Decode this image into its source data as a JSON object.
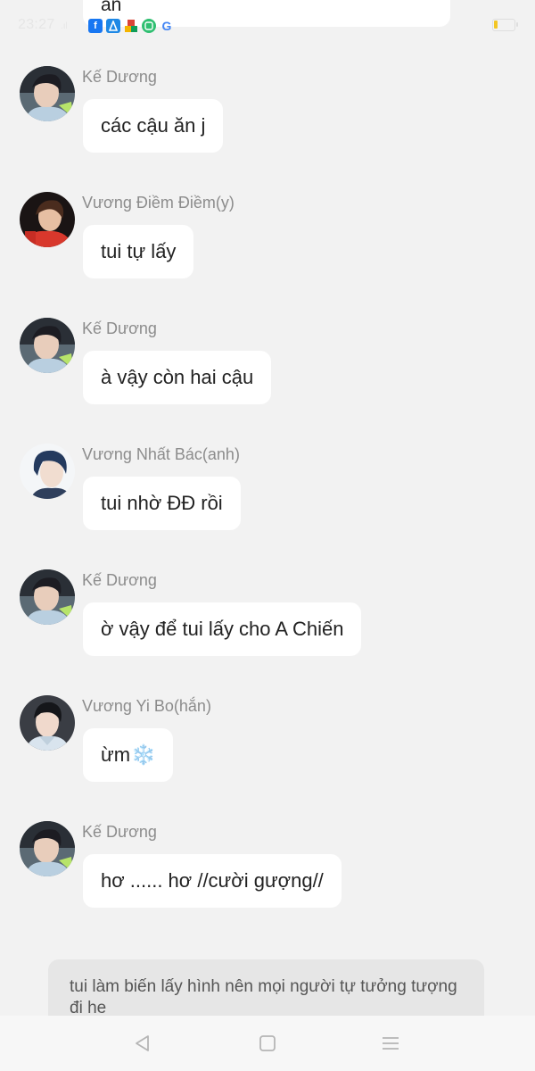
{
  "status_bar": {
    "time": "23:27",
    "signal": ".ıl",
    "notification_icons": [
      "facebook-icon",
      "app-icon",
      "puzzle-icon",
      "chat-app-icon",
      "google-icon"
    ]
  },
  "previous_message": {
    "text": "ăn"
  },
  "messages": [
    {
      "sender": "Kế Dương",
      "text": "các cậu ăn j",
      "avatar": "avatar-ke-duong"
    },
    {
      "sender": "Vương Điềm Điềm(y)",
      "text": "tui tự lấy",
      "avatar": "avatar-vuong-diem-diem"
    },
    {
      "sender": "Kế Dương",
      "text": "à vậy còn hai cậu",
      "avatar": "avatar-ke-duong"
    },
    {
      "sender": "Vương Nhất Bác(anh)",
      "text": "tui nhờ ĐĐ  rồi",
      "avatar": "avatar-vuong-nhat-bac"
    },
    {
      "sender": "Kế Dương",
      "text": "ờ vậy để tui lấy cho A Chiến",
      "avatar": "avatar-ke-duong"
    },
    {
      "sender": "Vương Yi Bo(hắn)",
      "text": "ừm",
      "emoji": "❄️",
      "avatar": "avatar-vuong-yi-bo"
    },
    {
      "sender": "Kế Dương",
      "text": "hơ ...... hơ //cười gượng//",
      "avatar": "avatar-ke-duong"
    }
  ],
  "notice": {
    "text": "tui làm biến lấy hình nên mọi người tự tưởng tượng đi he"
  },
  "nav_bar": {
    "buttons": [
      "back-icon",
      "home-icon",
      "recent-apps-icon"
    ]
  }
}
